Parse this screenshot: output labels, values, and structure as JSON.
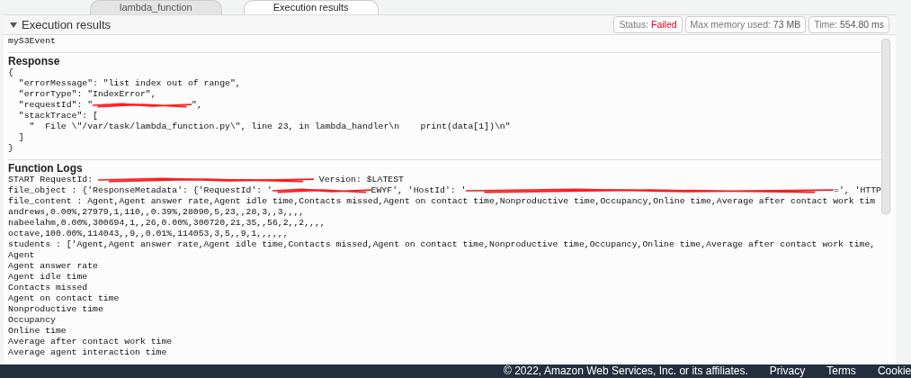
{
  "tabs": [
    {
      "label": "lambda_function",
      "selected": false
    },
    {
      "label": "Execution results",
      "selected": true
    }
  ],
  "panel": {
    "title": "Execution results",
    "expanded": true,
    "badges": [
      {
        "label": "Status:",
        "value": "Failed",
        "kind": "status"
      },
      {
        "label": "Max memory used:",
        "value": "73 MB",
        "kind": "plain"
      },
      {
        "label": "Time:",
        "value": "554.80 ms",
        "kind": "plain"
      }
    ]
  },
  "sections": [
    {
      "lines": [
        [
          {
            "kind": "text",
            "text": "myS3Event"
          }
        ]
      ]
    },
    {
      "heading": "Response",
      "lines": [
        [
          {
            "kind": "text",
            "text": "{"
          }
        ],
        [
          {
            "kind": "text",
            "text": "  \"errorMessage\": \"list index out of range\","
          }
        ],
        [
          {
            "kind": "text",
            "text": "  \"errorType\": \"IndexError\","
          }
        ],
        [
          {
            "kind": "text",
            "text": "  \"requestId\": \""
          },
          {
            "kind": "redactshort"
          },
          {
            "kind": "text",
            "text": "\","
          }
        ],
        [
          {
            "kind": "text",
            "text": "  \"stackTrace\": ["
          }
        ],
        [
          {
            "kind": "text",
            "text": "    \"  File \\\"/var/task/lambda_function.py\\\", line 23, in lambda_handler\\n    print(data[1])\\n\""
          }
        ],
        [
          {
            "kind": "text",
            "text": "  ]"
          }
        ],
        [
          {
            "kind": "text",
            "text": "}"
          }
        ]
      ]
    },
    {
      "heading": "Function Logs",
      "lines": [
        [
          {
            "kind": "text",
            "text": "START RequestId: "
          },
          {
            "kind": "redactlong"
          },
          {
            "kind": "text",
            "text": " Version: $LATEST"
          }
        ],
        [
          {
            "kind": "text",
            "text": "file_object : {'ResponseMetadata': {'RequestId': '"
          },
          {
            "kind": "redactshort"
          },
          {
            "kind": "text",
            "text": "EWYF', 'HostId': '"
          },
          {
            "kind": "redactwide"
          },
          {
            "kind": "text",
            "text": "=', 'HTTP"
          }
        ],
        [
          {
            "kind": "text",
            "text": "file_content : Agent,Agent answer rate,Agent idle time,Contacts missed,Agent on contact time,Nonproductive time,Occupancy,Online time,Average after contact work tim"
          }
        ],
        [
          {
            "kind": "text",
            "text": "andrews,0.00%,27979,1,110,,0.39%,28090,5,23,,28,3,,3,,,,"
          }
        ],
        [
          {
            "kind": "text",
            "text": "nabeelahm,0.00%,300694,1,,26,0.00%,300720,21,35,,56,2,,2,,,,"
          }
        ],
        [
          {
            "kind": "text",
            "text": "octave,100.00%,114043,,9,,0.01%,114053,3,5,,9,1,,,,,,"
          }
        ],
        [
          {
            "kind": "text",
            "text": "students : ['Agent,Agent answer rate,Agent idle time,Contacts missed,Agent on contact time,Nonproductive time,Occupancy,Online time,Average after contact work time,"
          }
        ],
        [
          {
            "kind": "text",
            "text": "Agent"
          }
        ],
        [
          {
            "kind": "text",
            "text": "Agent answer rate"
          }
        ],
        [
          {
            "kind": "text",
            "text": "Agent idle time"
          }
        ],
        [
          {
            "kind": "text",
            "text": "Contacts missed"
          }
        ],
        [
          {
            "kind": "text",
            "text": "Agent on contact time"
          }
        ],
        [
          {
            "kind": "text",
            "text": "Nonproductive time"
          }
        ],
        [
          {
            "kind": "text",
            "text": "Occupancy"
          }
        ],
        [
          {
            "kind": "text",
            "text": "Online time"
          }
        ],
        [
          {
            "kind": "text",
            "text": "Average after contact work time"
          }
        ],
        [
          {
            "kind": "text",
            "text": "Average agent interaction time"
          }
        ]
      ]
    }
  ],
  "footer": {
    "copyright": "© 2022, Amazon Web Services, Inc. or its affiliates.",
    "links": [
      "Privacy",
      "Terms",
      "Cookie"
    ]
  }
}
